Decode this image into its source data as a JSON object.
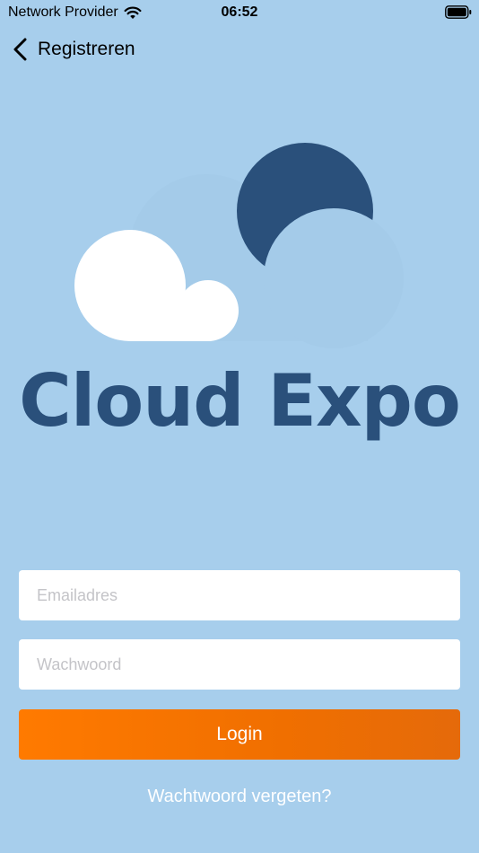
{
  "status_bar": {
    "carrier": "Network Provider",
    "time": "06:52",
    "wifi_icon": "wifi-icon",
    "battery_icon": "battery-icon"
  },
  "nav": {
    "back_icon": "chevron-left-icon",
    "back_label": "Registreren"
  },
  "logo": {
    "text": "Cloud Expo",
    "colors": {
      "brand_dark": "#2a507b",
      "cloud_light": "#a4cbe9",
      "cloud_white": "#ffffff"
    }
  },
  "form": {
    "email_placeholder": "Emailadres",
    "email_value": "",
    "password_placeholder": "Wachwoord",
    "password_value": "",
    "login_label": "Login",
    "forgot_label": "Wachtwoord vergeten?"
  },
  "colors": {
    "background": "#a7ceec",
    "accent": "#ff7a00"
  }
}
